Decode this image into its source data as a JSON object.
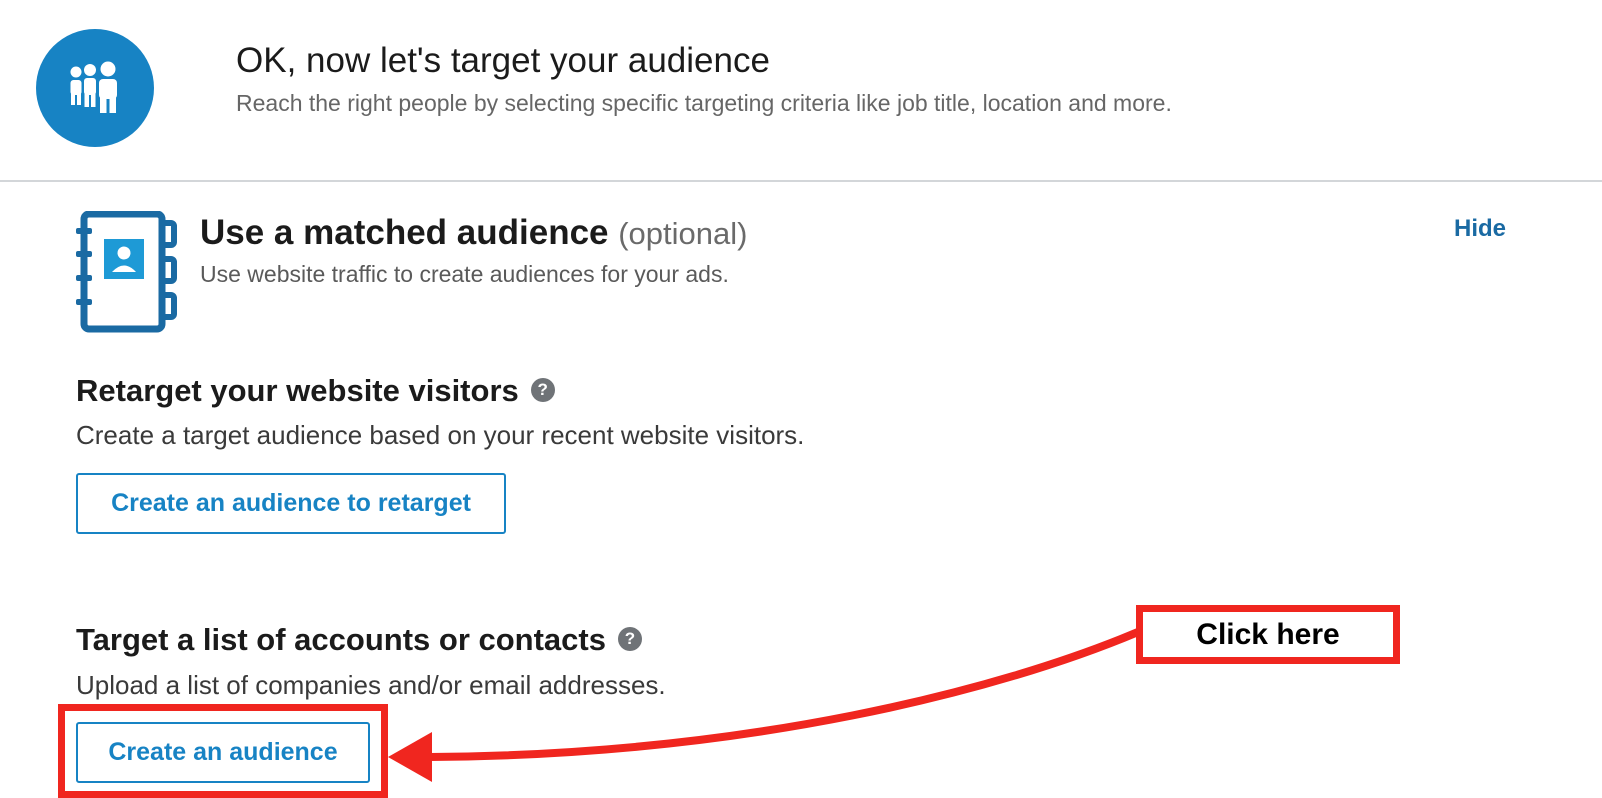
{
  "header": {
    "title": "OK, now let's target your audience",
    "subtitle": "Reach the right people by selecting specific targeting criteria like job title, location and more.",
    "icon": "audience-group-icon",
    "accent_color": "#1783c4"
  },
  "matched_audience": {
    "title": "Use a matched audience",
    "optional_label": "(optional)",
    "subtitle": "Use website traffic to create audiences for your ads.",
    "hide_label": "Hide",
    "icon": "contact-book-icon"
  },
  "retarget": {
    "heading": "Retarget your website visitors",
    "description": "Create a target audience based on your recent website visitors.",
    "button_label": "Create an audience to retarget",
    "help_glyph": "?"
  },
  "list_targeting": {
    "heading": "Target a list of accounts or contacts",
    "description": "Upload a list of companies and/or email addresses.",
    "button_label": "Create an audience",
    "help_glyph": "?"
  },
  "annotation": {
    "callout_text": "Click here",
    "color": "#f0261f"
  }
}
